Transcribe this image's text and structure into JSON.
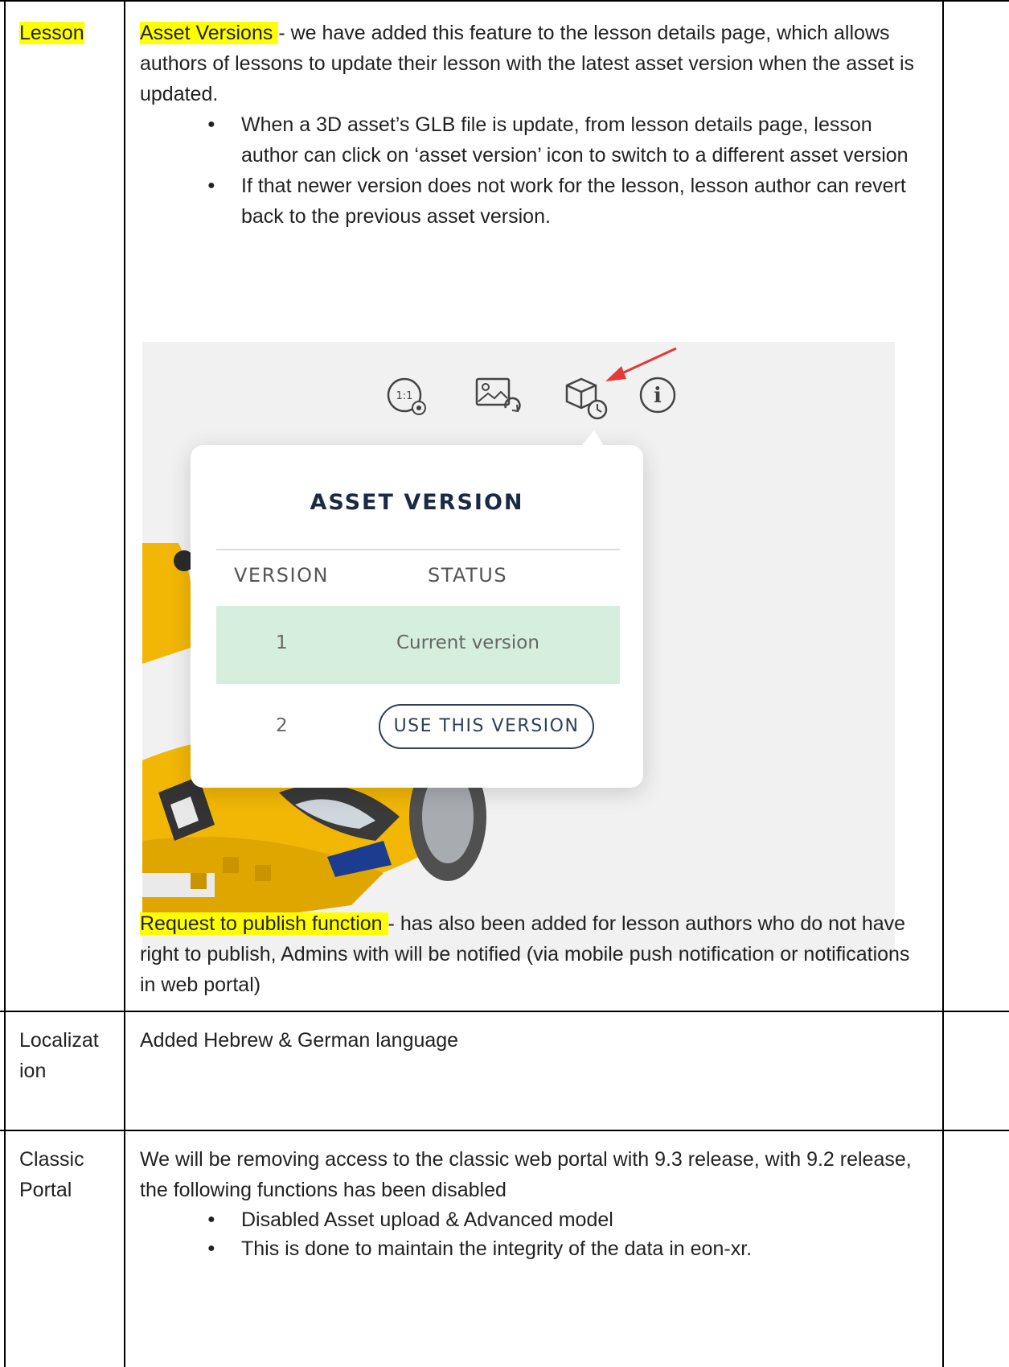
{
  "rows": {
    "lesson": {
      "label": "Lesson",
      "feature1_title": "Asset Versions ",
      "feature1_text": "- we have added this feature to the lesson details page, which allows authors of lessons to update their lesson with the latest asset version when the asset is updated.",
      "bullets": [
        "When a 3D asset’s GLB file is update, from lesson details page, lesson author can click on ‘asset version’ icon to switch to a different asset version",
        "If that newer version does not work for the lesson, lesson author can revert back to the previous asset version."
      ],
      "feature2_title": "Request to publish function ",
      "feature2_text": "- has also been added for lesson authors who do not have right to publish, Admins with will be notified (via mobile push notification or notifications in web portal)"
    },
    "localization": {
      "label_line1": "Localizat",
      "label_line2": "ion",
      "text": "Added Hebrew & German language"
    },
    "classic": {
      "label_line1": "Classic",
      "label_line2": "Portal",
      "text": "We will be removing access to the classic web portal with 9.3 release, with 9.2 release, the following functions has been disabled",
      "bullets": [
        "Disabled Asset upload & Advanced model",
        "This is done to maintain the integrity of the data in eon-xr."
      ]
    }
  },
  "screenshot": {
    "toolbar_icons": [
      "scale-settings-icon",
      "image-replace-icon",
      "asset-version-icon",
      "info-icon"
    ],
    "scale_text": "1:1",
    "info_glyph": "i",
    "arrow_color": "#e53935",
    "popup": {
      "title": "ASSET VERSION",
      "col_version": "VERSION",
      "col_status": "STATUS",
      "rows": [
        {
          "version": "1",
          "status": "Current version"
        },
        {
          "version": "2",
          "action": "USE THIS VERSION"
        }
      ],
      "current_row_color": "#d6eedd"
    },
    "car_colors": {
      "body": "#f2b705",
      "dark": "#2b2b2b"
    }
  }
}
